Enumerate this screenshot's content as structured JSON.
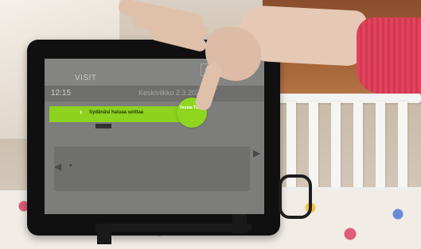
{
  "screen": {
    "brand": "VISIT",
    "clock": "12:15",
    "date": "Keskiviikko 2.3.2022",
    "corner_icon": "lock-icon",
    "call_banner": "Sydänäsi haluaa soittaa",
    "answer_button": "Vastaa Tästä",
    "accent_color": "#8ed11f"
  }
}
